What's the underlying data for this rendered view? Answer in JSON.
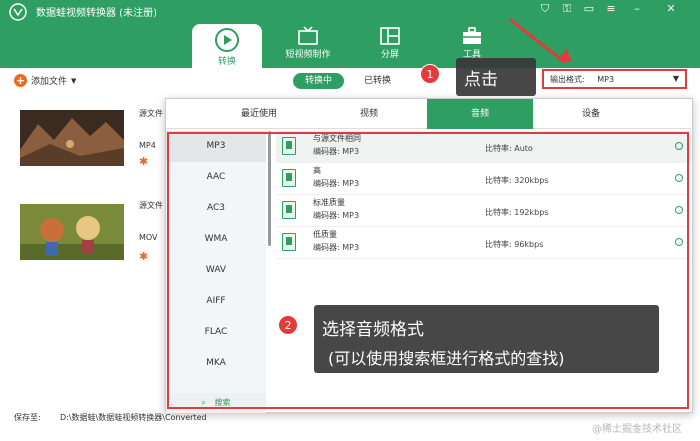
{
  "app": {
    "title": "数据蛙视频转换器 (未注册)"
  },
  "window_controls": [
    {
      "name": "cart-icon",
      "glyph": "⛉"
    },
    {
      "name": "key-icon",
      "glyph": "⚿"
    },
    {
      "name": "chat-icon",
      "glyph": "▭"
    },
    {
      "name": "menu-icon",
      "glyph": "≡"
    },
    {
      "name": "minimize-icon",
      "glyph": "–"
    },
    {
      "name": "close-icon",
      "glyph": "✕"
    }
  ],
  "nav": {
    "tabs": [
      {
        "label": "转换",
        "active": true
      },
      {
        "label": "短视频制作"
      },
      {
        "label": "分屏"
      },
      {
        "label": "工具"
      }
    ]
  },
  "toolbar": {
    "add_file": "添加文件",
    "converting": "转换中",
    "converted": "已转换",
    "output_format_label": "输出格式:",
    "output_format_value": "MP3"
  },
  "files": [
    {
      "source_label": "源文件",
      "format": "MP4"
    },
    {
      "source_label": "源文件",
      "format": "MOV"
    }
  ],
  "format_dropdown": {
    "tabs": [
      "最近使用",
      "视频",
      "音频",
      "设备"
    ],
    "active_tab": "音频",
    "formats": [
      "MP3",
      "AAC",
      "AC3",
      "WMA",
      "WAV",
      "AIFF",
      "FLAC",
      "MKA"
    ],
    "active_format": "MP3",
    "search": "搜索",
    "qualities": [
      {
        "name": "与源文件相同",
        "encoder": "编码器: MP3",
        "bitrate": "比特率: Auto"
      },
      {
        "name": "高",
        "encoder": "编码器: MP3",
        "bitrate": "比特率: 320kbps"
      },
      {
        "name": "标准质量",
        "encoder": "编码器: MP3",
        "bitrate": "比特率: 192kbps"
      },
      {
        "name": "低质量",
        "encoder": "编码器: MP3",
        "bitrate": "比特率: 96kbps"
      }
    ]
  },
  "bottom": {
    "save_label": "保存至:",
    "save_path": "D:\\数据蛙\\数据蛙视频转换器\\Converted",
    "watermark": "@稀土掘金技术社区"
  },
  "annotations": [
    {
      "number": "1",
      "text": "点击"
    },
    {
      "number": "2",
      "text": "选择音频格式",
      "subtext": "(可以使用搜索框进行格式的查找)"
    }
  ],
  "colors": {
    "brand": "#2e9e62",
    "accent": "#e23b3b",
    "add_button": "#f06a1e"
  }
}
